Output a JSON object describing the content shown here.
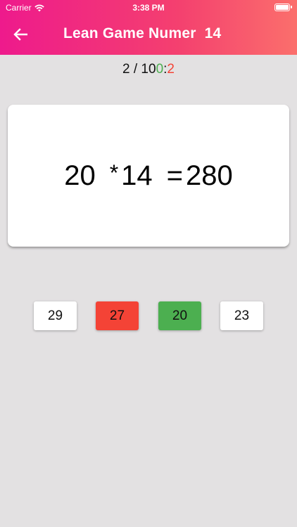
{
  "status_bar": {
    "carrier": "Carrier",
    "time": "3:38 PM"
  },
  "header": {
    "title": "Lean Game Numer  14",
    "back_icon": "arrow-left-icon"
  },
  "score": {
    "current": "2",
    "separator": " / ",
    "total": "10",
    "correct": "0",
    "colon": ":",
    "wrong": "2"
  },
  "question": {
    "left_operand": "20",
    "operator": "*",
    "right_operand": "14",
    "equals": "=",
    "result": "280"
  },
  "answers": [
    {
      "label": "29",
      "state": "neutral"
    },
    {
      "label": "27",
      "state": "wrong"
    },
    {
      "label": "20",
      "state": "correct"
    },
    {
      "label": "23",
      "state": "neutral"
    }
  ],
  "colors": {
    "gradient_start": "#ee1a8c",
    "gradient_end": "#fb6f6c",
    "correct": "#4caf50",
    "wrong": "#f44336",
    "neutral": "#ffffff",
    "background": "#e3e1e2"
  }
}
